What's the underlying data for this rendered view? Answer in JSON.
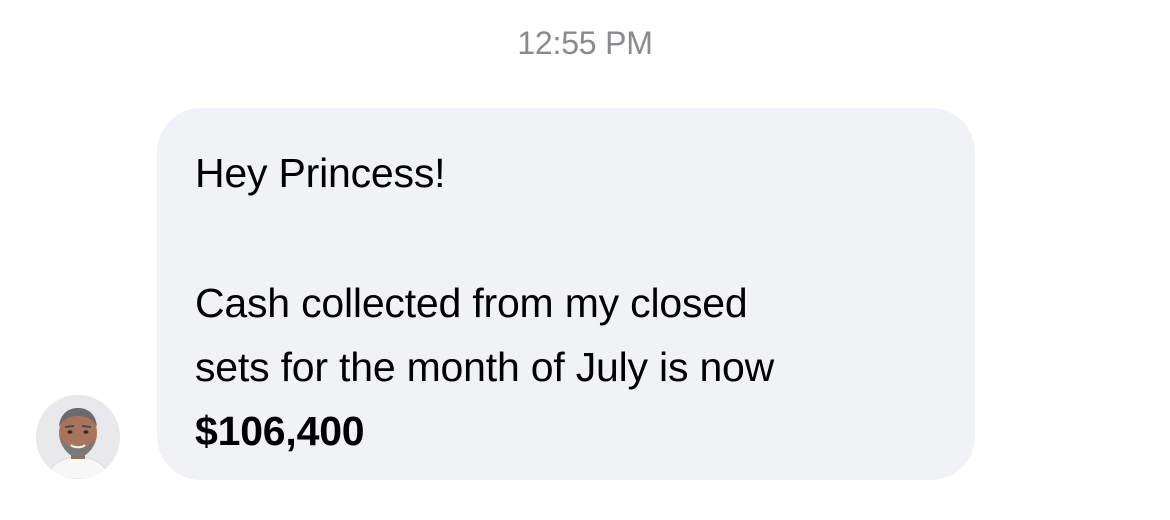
{
  "conversation": {
    "timestamp": "12:55 PM",
    "message": {
      "greeting": "Hey Princess!",
      "line_1": "Cash collected from my closed",
      "line_2": "sets for the month of July is now",
      "amount": "$106,400"
    },
    "sender": {
      "avatar_icon": "person-avatar"
    }
  },
  "colors": {
    "bubble_background": "#f1f2f6",
    "timestamp_text": "#8a8a8e",
    "message_text": "#000000"
  }
}
